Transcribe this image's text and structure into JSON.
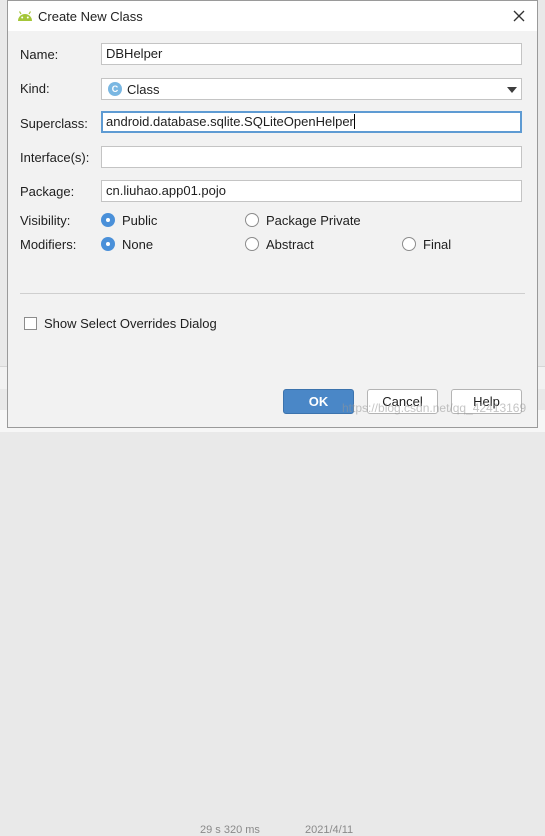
{
  "dialog": {
    "title": "Create New Class"
  },
  "fields": {
    "name": {
      "label": "Name:",
      "value": "DBHelper"
    },
    "kind": {
      "label": "Kind:",
      "value": "Class",
      "icon_letter": "C"
    },
    "superclass": {
      "label": "Superclass:",
      "value": "android.database.sqlite.SQLiteOpenHelper"
    },
    "interfaces": {
      "label": "Interface(s):",
      "value": ""
    },
    "package": {
      "label": "Package:",
      "value": "cn.liuhao.app01.pojo"
    }
  },
  "visibility": {
    "label": "Visibility:",
    "options": [
      "Public",
      "Package Private"
    ],
    "selected": "Public"
  },
  "modifiers": {
    "label": "Modifiers:",
    "options": [
      "None",
      "Abstract",
      "Final"
    ],
    "selected": "None"
  },
  "overrides_checkbox": {
    "label": "Show Select Overrides Dialog",
    "checked": false
  },
  "buttons": {
    "ok": "OK",
    "cancel": "Cancel",
    "help": "Help"
  },
  "background": {
    "left_text": "29 s 320 ms",
    "right_text": "2021/4/11",
    "watermark": "https://blog.csdn.net/qq_42413169"
  },
  "colors": {
    "accent": "#4a90d9",
    "ok_button": "#4a87c7",
    "focus_border": "#5e9bd3",
    "android_green": "#a4c639"
  }
}
